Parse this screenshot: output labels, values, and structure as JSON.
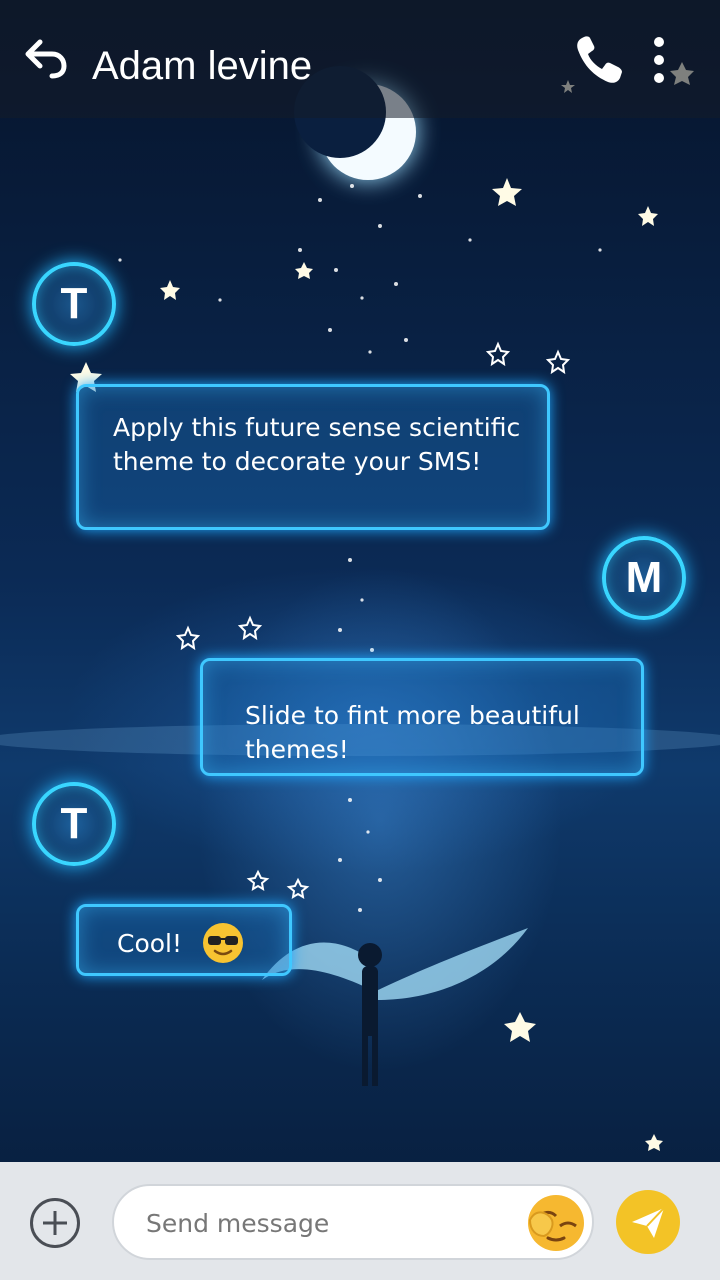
{
  "header": {
    "contact_name": "Adam levine",
    "icons": {
      "back": "back-arrow-icon",
      "call": "phone-icon",
      "menu": "more-vert-icon"
    }
  },
  "messages": [
    {
      "avatar_letter": "T",
      "direction": "incoming",
      "text": "Apply this future sense scientific theme to decorate your SMS!"
    },
    {
      "avatar_letter": "M",
      "direction": "outgoing",
      "text": "Slide to fint more beautiful themes!"
    },
    {
      "avatar_letter": "T",
      "direction": "incoming",
      "text": "Cool!",
      "emoji": "sunglasses-emoji"
    }
  ],
  "composer": {
    "placeholder": "Send message",
    "icons": {
      "add": "add-circle-icon",
      "emoji": "face-palm-emoji",
      "send": "paper-plane-icon"
    }
  },
  "colors": {
    "accent": "#3fc8ff",
    "header_bg": "#141c28",
    "footer_bg": "#e3e6ea",
    "send_button": "#f3c326",
    "sky_top": "#06142b",
    "sky_mid": "#0f3a6c"
  }
}
